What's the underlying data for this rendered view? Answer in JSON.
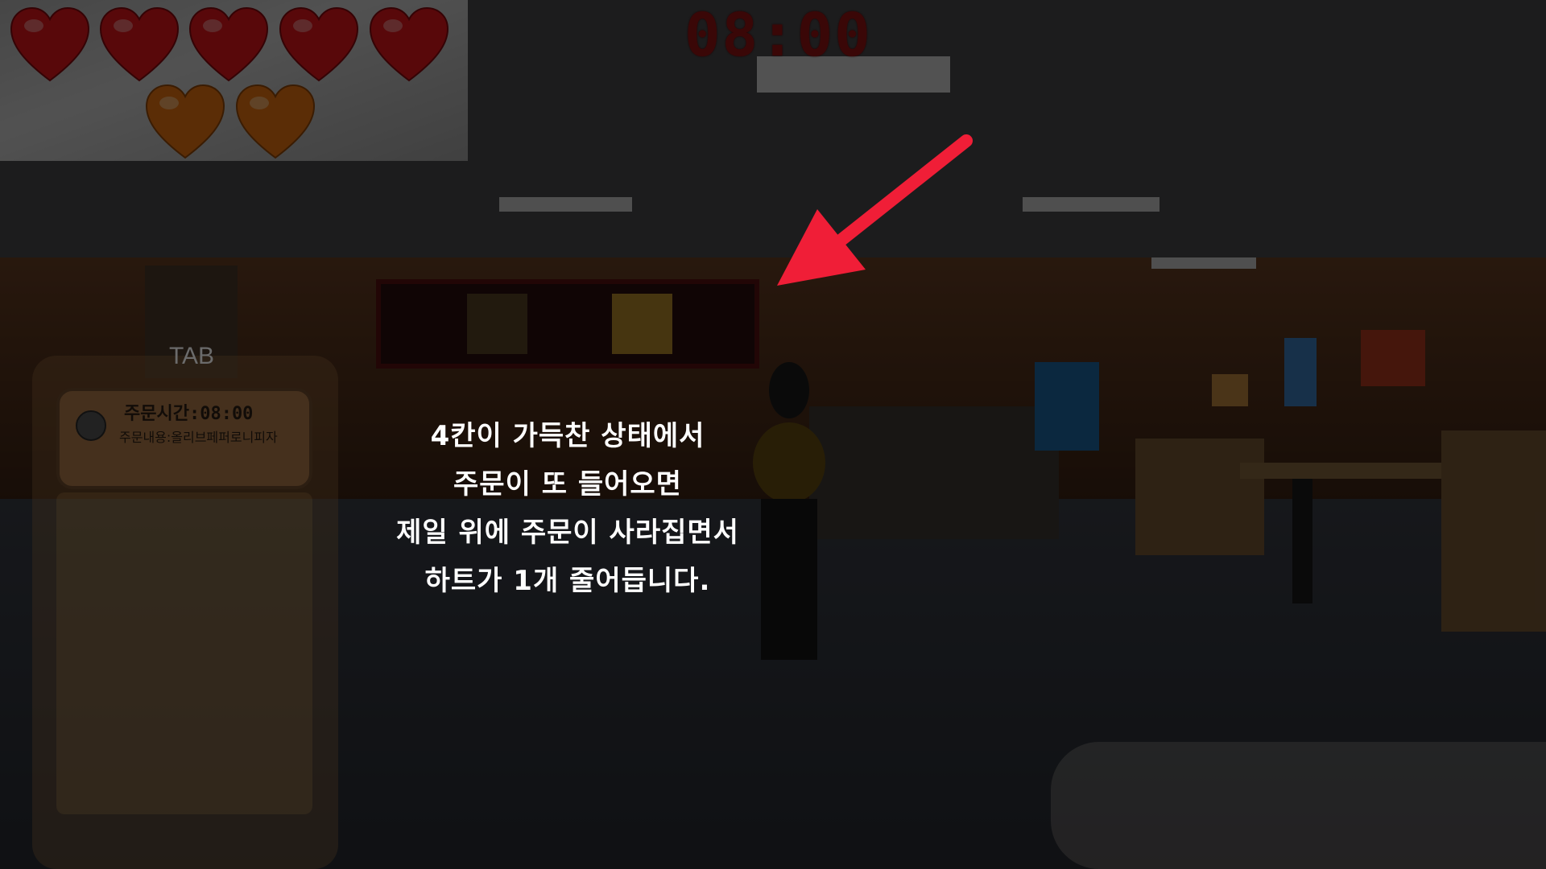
{
  "hud": {
    "timer": "08:00",
    "hearts": [
      {
        "type": "red-heart",
        "color": "#e8151c"
      },
      {
        "type": "red-heart",
        "color": "#e8151c"
      },
      {
        "type": "red-heart",
        "color": "#e8151c"
      },
      {
        "type": "red-heart",
        "color": "#e8151c"
      },
      {
        "type": "red-heart",
        "color": "#e8151c"
      },
      {
        "type": "orange-heart",
        "color": "#f07812"
      },
      {
        "type": "orange-heart",
        "color": "#f07812"
      }
    ]
  },
  "orders": {
    "tab_label": "TAB",
    "card": {
      "time_label": "주문시간:08:00",
      "content_label": "주문내용:올리브페퍼로니피자"
    }
  },
  "tutorial": {
    "lines": [
      "4칸이 가득찬 상태에서",
      "주문이 또 들어오면",
      "제일 위에 주문이 사라집면서",
      "하트가 1개 줄어듭니다."
    ]
  },
  "colors": {
    "arrow": "#f01e37",
    "overlay": "rgba(0,0,0,0.62)"
  },
  "icons": [
    "arrow-pointer-icon",
    "red-heart-icon",
    "orange-heart-icon"
  ]
}
